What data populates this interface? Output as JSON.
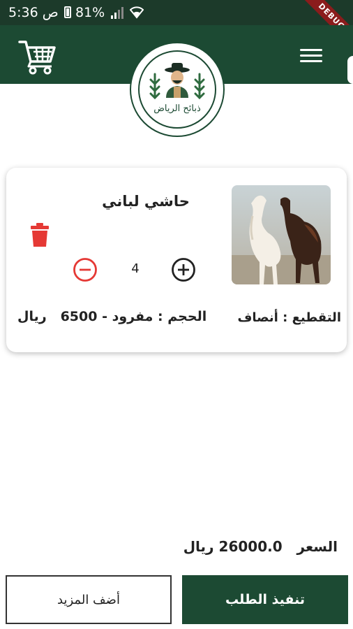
{
  "status_bar": {
    "time": "5:36 ص",
    "battery": "81%",
    "debug_banner": "DEBUG"
  },
  "app": {
    "logo_text": "ذبائح الرياض",
    "brand_color": "#1c4a33"
  },
  "cart": {
    "item": {
      "name": "حاشي لباني",
      "quantity": "4",
      "cutting_label": "التقطيع",
      "cutting_value": "أنصاف",
      "size_label": "الحجم",
      "size_value": "مفرود",
      "price": "6500",
      "currency": "ريال"
    },
    "total_label": "السعر",
    "total_value": "26000.0",
    "total_currency": "ريال"
  },
  "actions": {
    "checkout_label": "تنفيذ الطلب",
    "add_more_label": "أضف المزيد"
  }
}
